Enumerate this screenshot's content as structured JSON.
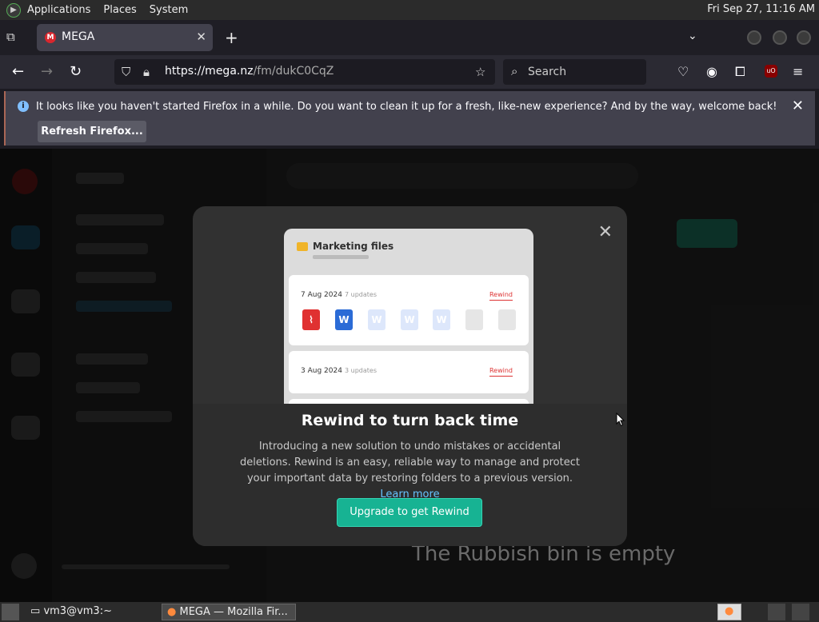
{
  "system_bar": {
    "menus": [
      "Applications",
      "Places",
      "System"
    ],
    "clock": "Fri Sep 27, 11:16 AM"
  },
  "browser": {
    "tab": {
      "title": "MEGA",
      "favicon": "M"
    },
    "url_host": "https://mega.nz",
    "url_path": "/fm/dukC0CqZ",
    "search_placeholder": "Search",
    "notification": {
      "message": "It looks like you haven't started Firefox in a while. Do you want to clean it up for a fresh, like-new experience? And by the way, welcome back!",
      "button": "Refresh Firefox..."
    }
  },
  "modal": {
    "preview": {
      "folder_title": "Marketing files",
      "card1_date": "7 Aug 2024",
      "card1_updates": "7 updates",
      "card2_date": "3 Aug 2024",
      "card2_updates": "3 updates",
      "rewind_label": "Rewind",
      "word_glyph": "W"
    },
    "title": "Rewind to turn back time",
    "description": "Introducing a new solution to undo mistakes or accidental deletions. Rewind is an easy, reliable way to manage and protect your important data by restoring folders to a previous version.",
    "link": "Learn more",
    "button": "Upgrade to get Rewind"
  },
  "background_text": "The Rubbish bin is empty",
  "taskbar": {
    "items": [
      "vm3@vm3:~",
      "MEGA — Mozilla Fir..."
    ]
  },
  "colors": {
    "accent": "#17b393",
    "link": "#66c3ff",
    "mega_red": "#d9272e"
  }
}
